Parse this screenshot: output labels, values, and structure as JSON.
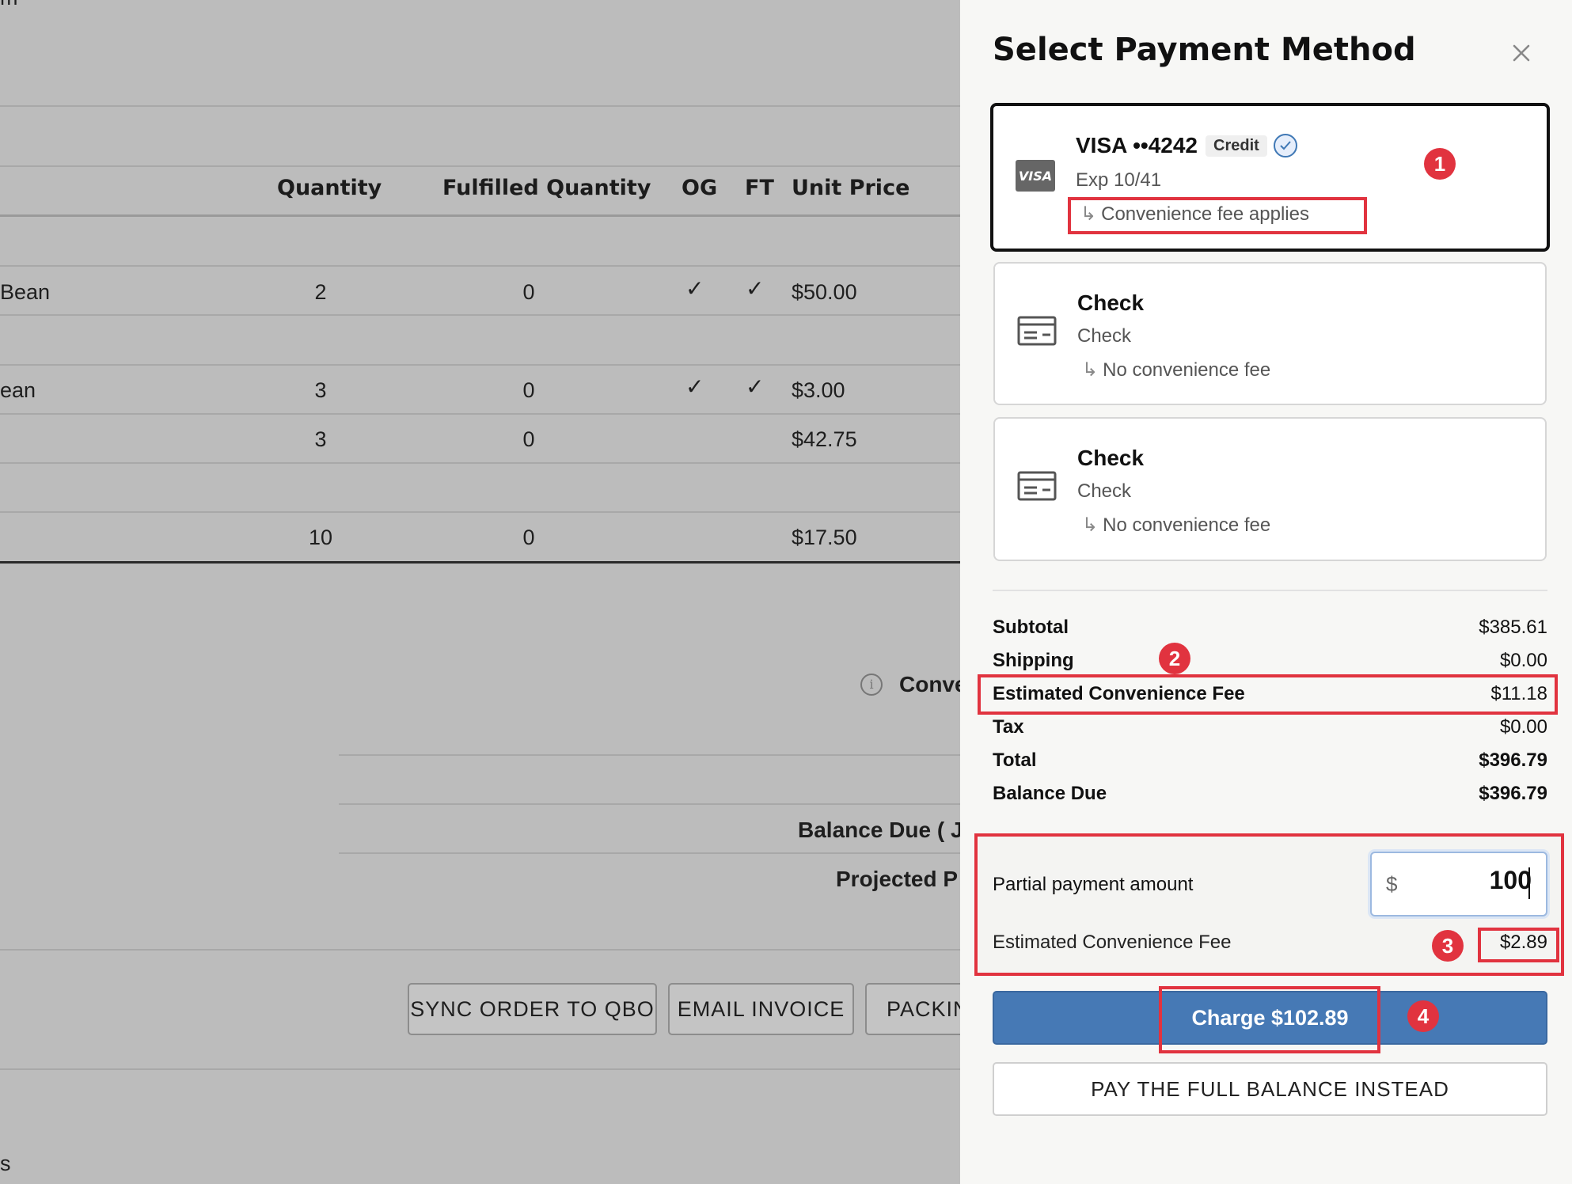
{
  "background": {
    "top_fragment": "m",
    "table": {
      "headers": [
        "Quantity",
        "Fulfilled Quantity",
        "OG",
        "FT",
        "Unit Price"
      ],
      "rows": [
        {
          "name": "Bean",
          "quantity": "2",
          "fulfilled": "0",
          "og": "✓",
          "ft": "✓",
          "unit_price": "$50.00"
        },
        {
          "name": "ean",
          "quantity": "3",
          "fulfilled": "0",
          "og": "✓",
          "ft": "✓",
          "unit_price": "$3.00"
        },
        {
          "name": "",
          "quantity": "3",
          "fulfilled": "0",
          "og": "",
          "ft": "",
          "unit_price": "$42.75"
        },
        {
          "name": "",
          "quantity": "10",
          "fulfilled": "0",
          "og": "",
          "ft": "",
          "unit_price": "$17.50"
        }
      ]
    },
    "conv_fragment": "Conve",
    "balance_due_fragment": "Balance Due ( J",
    "projected_fragment": "Projected P",
    "buttons": [
      "SYNC ORDER TO QBO",
      "EMAIL INVOICE",
      "PACKIN"
    ],
    "bottom_fragment": "s"
  },
  "drawer": {
    "title": "Select Payment Method",
    "methods": [
      {
        "brand_icon": "VISA",
        "title": "VISA ••4242",
        "badge": "Credit",
        "subtitle": "Exp 10/41",
        "fee_note": "Convenience fee applies",
        "selected": true
      },
      {
        "title": "Check",
        "subtitle": "Check",
        "fee_note": "No convenience fee",
        "selected": false
      },
      {
        "title": "Check",
        "subtitle": "Check",
        "fee_note": "No convenience fee",
        "selected": false
      }
    ],
    "summary": [
      {
        "label": "Subtotal",
        "value": "$385.61"
      },
      {
        "label": "Shipping",
        "value": "$0.00"
      },
      {
        "label": "Estimated Convenience Fee",
        "value": "$11.18"
      },
      {
        "label": "Tax",
        "value": "$0.00"
      },
      {
        "label": "Total",
        "value": "$396.79"
      },
      {
        "label": "Balance Due",
        "value": "$396.79"
      }
    ],
    "partial": {
      "label": "Partial payment amount",
      "currency": "$",
      "value": "100",
      "fee_label": "Estimated Convenience Fee",
      "fee_value": "$2.89"
    },
    "charge_label": "Charge $102.89",
    "full_balance_label": "PAY THE FULL BALANCE INSTEAD"
  },
  "annotations": [
    "1",
    "2",
    "3",
    "4"
  ],
  "colors": {
    "accent": "#4679b5",
    "annotation_red": "#e1333f"
  }
}
